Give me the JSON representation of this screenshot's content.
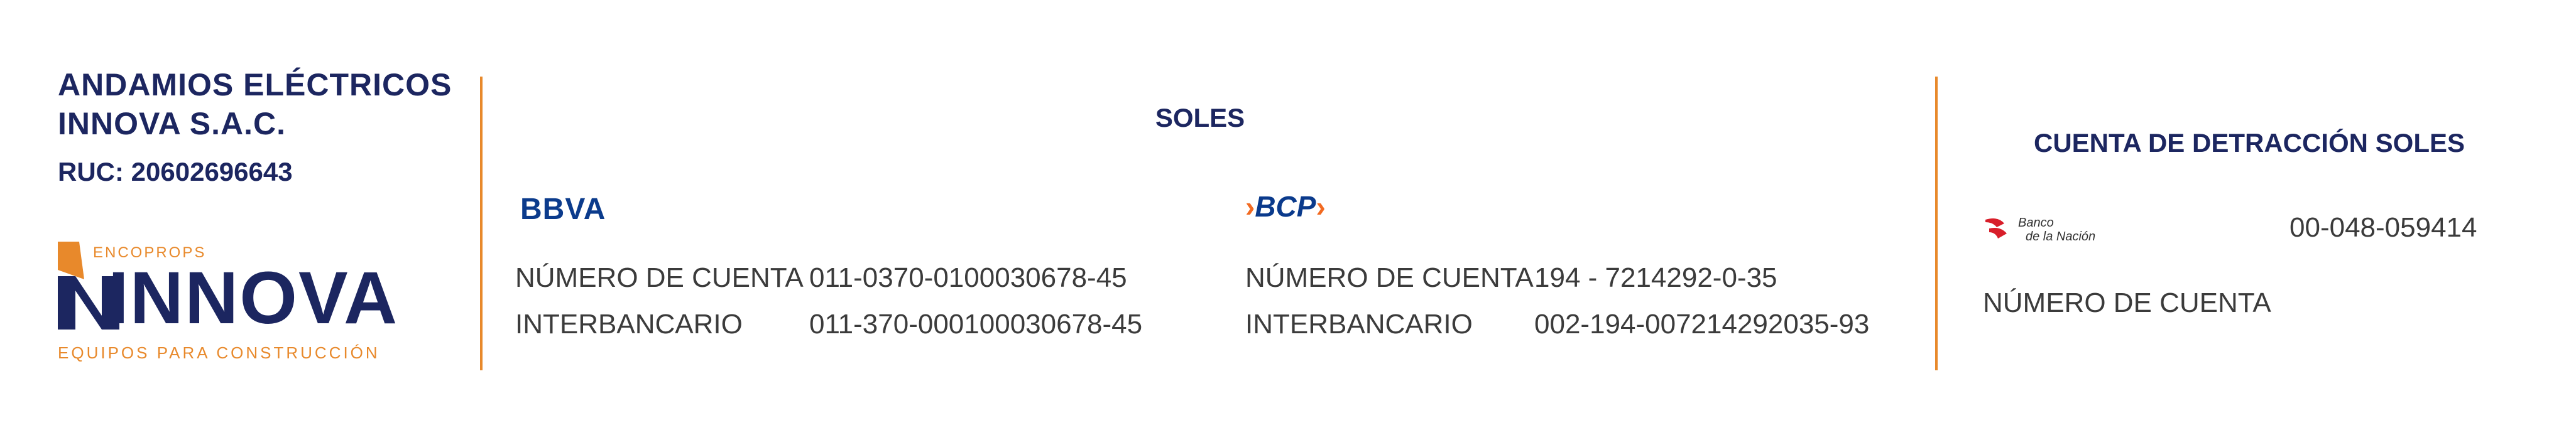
{
  "company": {
    "name_line1": "ANDAMIOS ELÉCTRICOS",
    "name_line2": "INNOVA S.A.C.",
    "ruc": "RUC: 20602696643"
  },
  "logo": {
    "top_text": "ENCOPROPS",
    "brand": "INNOVA",
    "tagline": "EQUIPOS PARA CONSTRUCCIÓN",
    "colors": {
      "navy": "#1c2660",
      "orange": "#e8892b"
    }
  },
  "soles": {
    "title": "SOLES",
    "bbva": {
      "logo_text": "BBVA",
      "rows": [
        {
          "label": "NÚMERO DE CUENTA",
          "value": "011-0370-0100030678-45"
        },
        {
          "label": "INTERBANCARIO",
          "value": "011-370-000100030678-45"
        }
      ]
    },
    "bcp": {
      "logo_text": "BCP",
      "rows": [
        {
          "label": "NÚMERO DE CUENTA",
          "value": "194 - 7214292-0-35"
        },
        {
          "label": "INTERBANCARIO",
          "value": "002-194-007214292035-93"
        }
      ]
    }
  },
  "detraccion": {
    "title": "CUENTA DE DETRACCIÓN SOLES",
    "bank_logo_line1": "Banco",
    "bank_logo_line2": "de la Nación",
    "account_number": "00-048-059414",
    "label": "NÚMERO DE CUENTA"
  }
}
